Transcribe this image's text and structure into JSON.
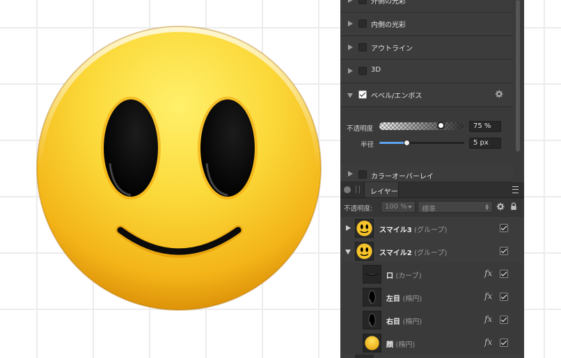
{
  "effects": {
    "items": [
      {
        "label": "外側の光彩",
        "checked": false
      },
      {
        "label": "内側の光彩",
        "checked": false
      },
      {
        "label": "アウトライン",
        "checked": false
      },
      {
        "label": "3D",
        "checked": false
      },
      {
        "label": "ベベル/エンボス",
        "checked": true
      },
      {
        "label": "カラーオーバーレイ",
        "checked": false
      }
    ],
    "bevel": {
      "opacity_label": "不透明度",
      "opacity_value": "75 %",
      "radius_label": "半径",
      "radius_value": "5 px"
    }
  },
  "layers_panel": {
    "tab_label": "レイヤー",
    "opacity_label": "不透明度:",
    "opacity_value": "100 %",
    "blend_mode": "標準",
    "rows": [
      {
        "name": "スマイル3",
        "type": "(グループ)",
        "expanded": false
      },
      {
        "name": "スマイル2",
        "type": "(グループ)",
        "expanded": true
      },
      {
        "name": "口",
        "type": "(カーブ)",
        "fx": "fx"
      },
      {
        "name": "左目",
        "type": "(楕円)",
        "fx": "fx"
      },
      {
        "name": "右目",
        "type": "(楕円)",
        "fx": "fx"
      },
      {
        "name": "顔",
        "type": "(楕円)",
        "fx": "fx"
      }
    ]
  }
}
